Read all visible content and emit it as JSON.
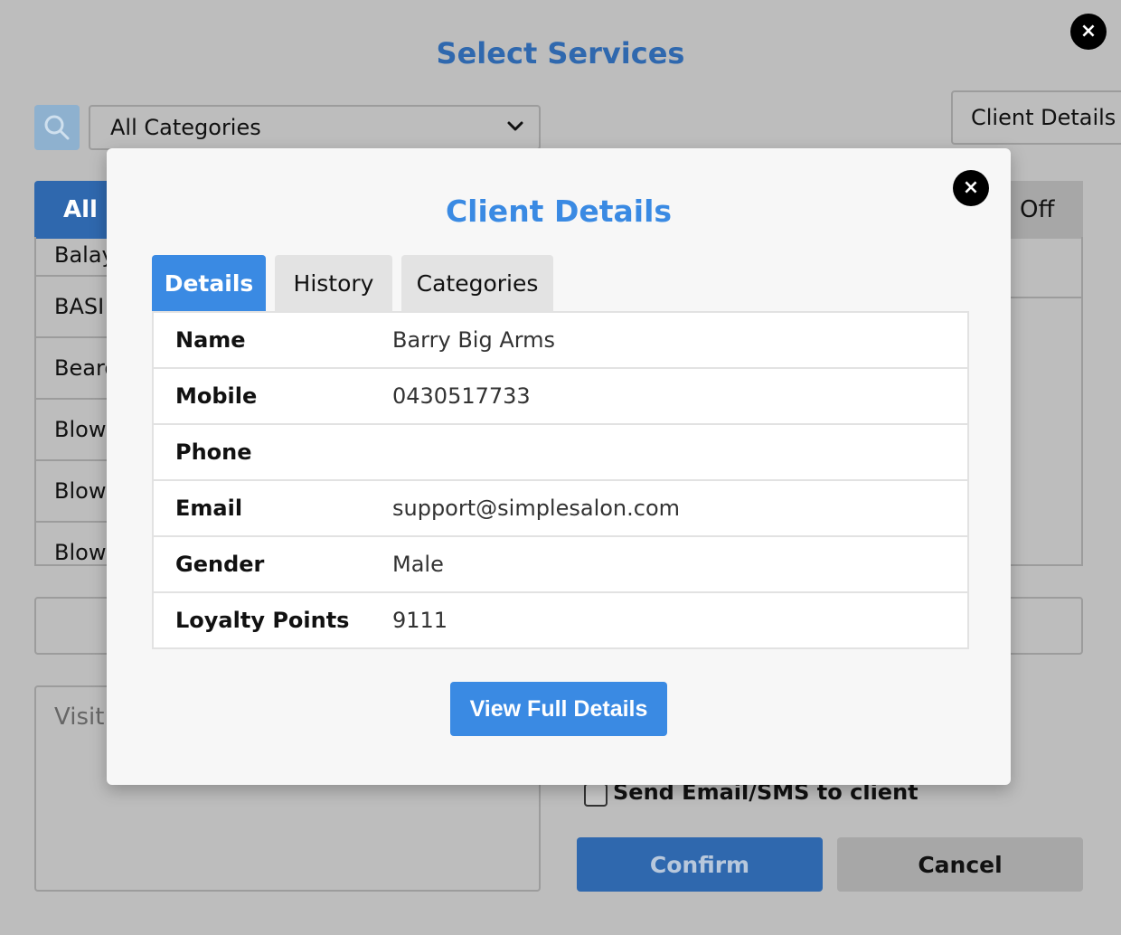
{
  "background": {
    "title": "Select Services",
    "close_icon": "×",
    "search_icon": "search-icon",
    "category_select": {
      "value": "All Categories",
      "chevron": "⌄"
    },
    "client_details_button": "Client Details",
    "tabs": {
      "all": "All",
      "off": "Off"
    },
    "services": [
      "Balay",
      "BASI",
      "Beard",
      "Blow",
      "Blow",
      "Blow"
    ],
    "visit_notes_placeholder": "Visit",
    "send_email_label": "Send Email/SMS to client",
    "confirm_label": "Confirm",
    "cancel_label": "Cancel"
  },
  "modal": {
    "title": "Client Details",
    "close_icon": "×",
    "tabs": [
      {
        "label": "Details",
        "active": true
      },
      {
        "label": "History",
        "active": false
      },
      {
        "label": "Categories",
        "active": false
      }
    ],
    "rows": [
      {
        "label": "Name",
        "value": "Barry Big Arms"
      },
      {
        "label": "Mobile",
        "value": "0430517733"
      },
      {
        "label": "Phone",
        "value": ""
      },
      {
        "label": "Email",
        "value": "support@simplesalon.com"
      },
      {
        "label": "Gender",
        "value": "Male"
      },
      {
        "label": "Loyalty Points",
        "value": "9111"
      }
    ],
    "view_full_details_label": "View Full Details"
  },
  "colors": {
    "modal_accent": "#3a8ae3",
    "background_accent": "#2f68ae",
    "overlay": "#bdbdbd"
  }
}
